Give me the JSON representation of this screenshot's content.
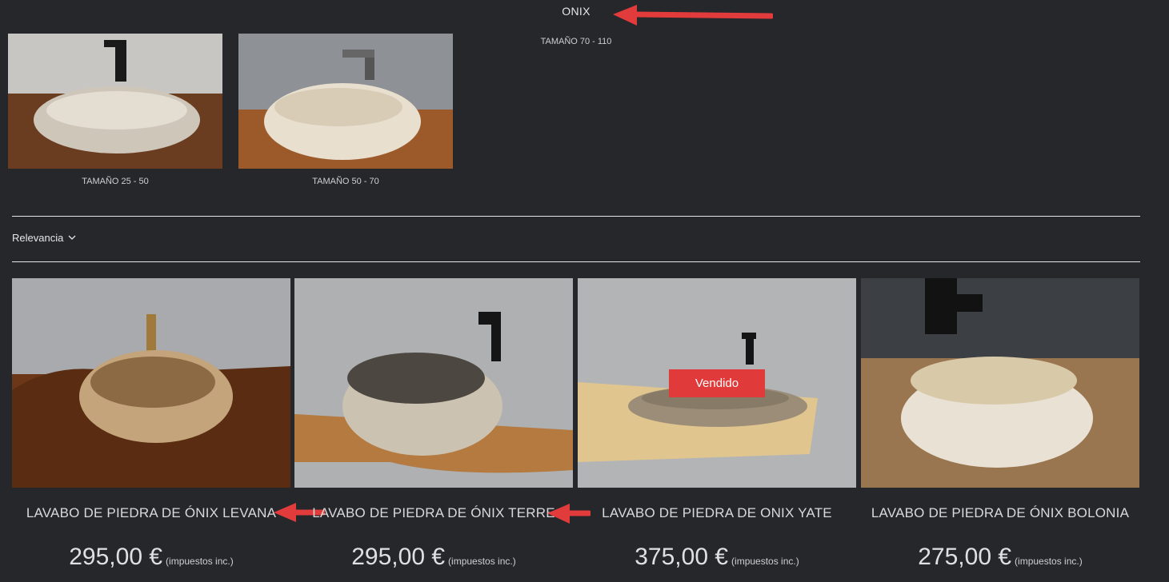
{
  "category": {
    "title": "ONIX",
    "subtitle": "TAMAÑO 70 - 110",
    "subcategories": [
      {
        "label": "TAMAÑO 25 - 50"
      },
      {
        "label": "TAMAÑO 50 - 70"
      }
    ]
  },
  "sort": {
    "label": "Relevancia",
    "icon": "chevron-down-icon"
  },
  "products": [
    {
      "name": "LAVABO DE PIEDRA DE ÓNIX LEVANA",
      "price": "295,00 €",
      "tax": "(impuestos inc.)"
    },
    {
      "name": "LAVABO DE PIEDRA DE ÓNIX TERRE",
      "price": "295,00 €",
      "tax": "(impuestos inc.)"
    },
    {
      "name": "LAVABO DE PIEDRA DE ONIX YATE",
      "price": "375,00 €",
      "tax": "(impuestos inc.)",
      "badge": "Vendido"
    },
    {
      "name": "LAVABO DE PIEDRA DE ÓNIX BOLONIA",
      "price": "275,00 €",
      "tax": "(impuestos inc.)"
    }
  ],
  "annotations": {
    "arrow_color": "#e23b3b",
    "icon": "red-arrow-icon"
  },
  "colors": {
    "background": "#26272b",
    "sold_badge": "#e03a3a"
  }
}
